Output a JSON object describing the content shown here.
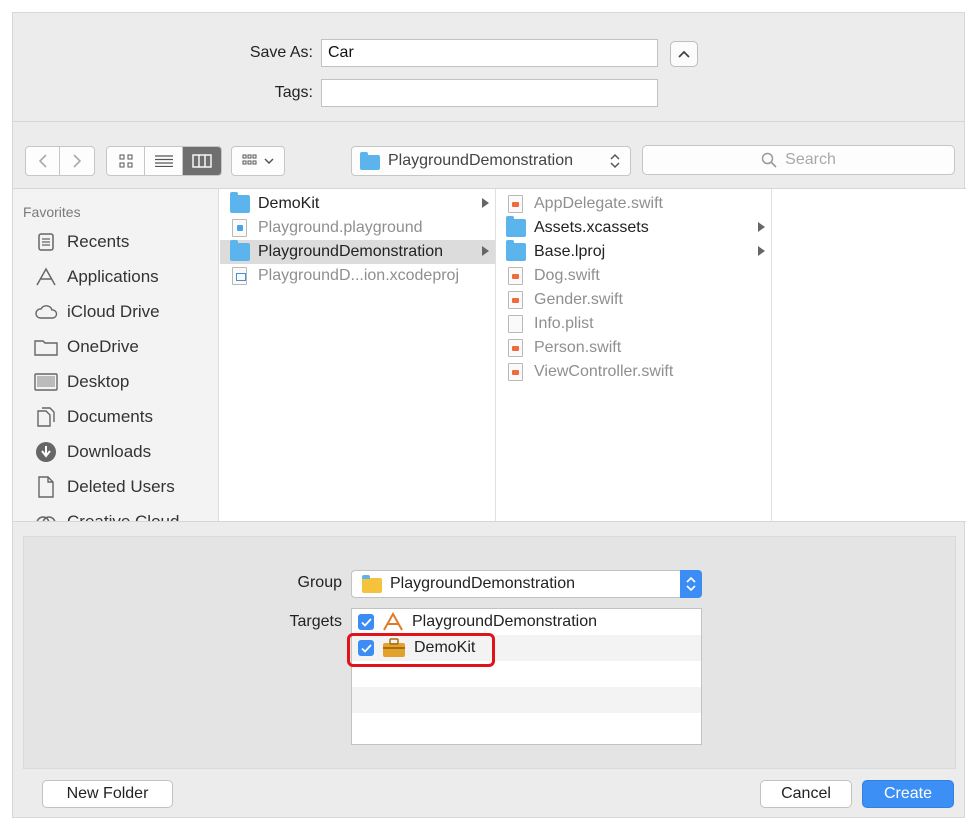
{
  "save_as": {
    "label": "Save As:",
    "value": "Car"
  },
  "tags": {
    "label": "Tags:",
    "value": ""
  },
  "toolbar": {
    "path_popup": "PlaygroundDemonstration",
    "search_placeholder": "Search"
  },
  "sidebar": {
    "heading": "Favorites",
    "items": [
      {
        "label": "Recents",
        "icon": "recents-icon"
      },
      {
        "label": "Applications",
        "icon": "applications-icon"
      },
      {
        "label": "iCloud Drive",
        "icon": "cloud-icon"
      },
      {
        "label": "OneDrive",
        "icon": "folder-icon"
      },
      {
        "label": "Desktop",
        "icon": "desktop-icon"
      },
      {
        "label": "Documents",
        "icon": "documents-icon"
      },
      {
        "label": "Downloads",
        "icon": "downloads-icon"
      },
      {
        "label": "Deleted Users",
        "icon": "document-icon"
      },
      {
        "label": "Creative Cloud",
        "icon": "creative-cloud-icon"
      }
    ]
  },
  "column1": [
    {
      "name": "DemoKit",
      "kind": "folder"
    },
    {
      "name": "Playground.playground",
      "kind": "playground"
    },
    {
      "name": "PlaygroundDemonstration",
      "kind": "folder",
      "selected": true
    },
    {
      "name": "PlaygroundD...ion.xcodeproj",
      "kind": "xcodeproj"
    }
  ],
  "column2": [
    {
      "name": "AppDelegate.swift",
      "kind": "swift"
    },
    {
      "name": "Assets.xcassets",
      "kind": "folder"
    },
    {
      "name": "Base.lproj",
      "kind": "folder"
    },
    {
      "name": "Dog.swift",
      "kind": "swift"
    },
    {
      "name": "Gender.swift",
      "kind": "swift"
    },
    {
      "name": "Info.plist",
      "kind": "plist"
    },
    {
      "name": "Person.swift",
      "kind": "swift"
    },
    {
      "name": "ViewController.swift",
      "kind": "swift"
    }
  ],
  "group": {
    "label": "Group",
    "value": "PlaygroundDemonstration"
  },
  "targets": {
    "label": "Targets",
    "items": [
      {
        "name": "PlaygroundDemonstration",
        "checked": true,
        "icon": "app-target-icon"
      },
      {
        "name": "DemoKit",
        "checked": true,
        "icon": "framework-target-icon"
      }
    ]
  },
  "buttons": {
    "new_folder": "New Folder",
    "cancel": "Cancel",
    "create": "Create"
  },
  "colors": {
    "accent": "#3c8ff5",
    "highlight": "#e0131a",
    "folder": "#5bb4ec"
  }
}
